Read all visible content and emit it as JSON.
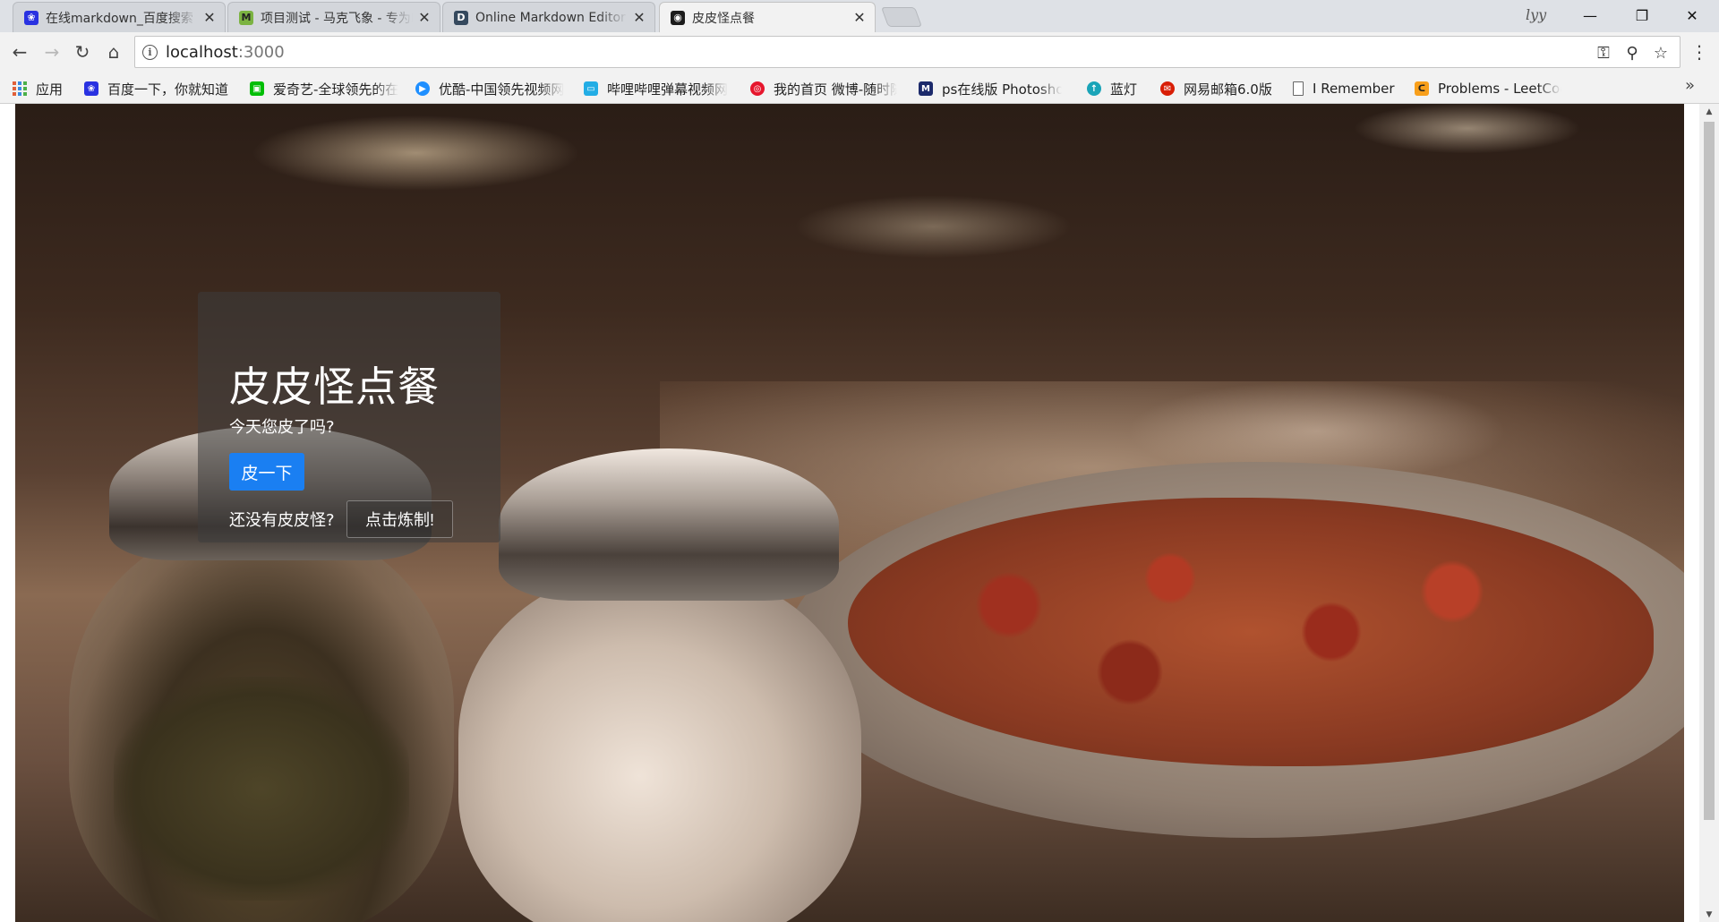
{
  "browser": {
    "tabs": [
      {
        "title": "在线markdown_百度搜索",
        "favicon": "baidu-paw-icon",
        "color": "#2932e1",
        "active": false
      },
      {
        "title": "项目测试 - 马克飞象 - 专为印象笔记打造的Markdown编辑器",
        "favicon": "maxiang-m-icon",
        "color": "#7cb342",
        "active": false
      },
      {
        "title": "Online Markdown Editor - Dillinger",
        "favicon": "dillinger-d-icon",
        "color": "#35495e",
        "active": false
      },
      {
        "title": "皮皮怪点餐",
        "favicon": "page-icon",
        "color": "#1b1b1b",
        "active": true
      }
    ],
    "close_glyph": "✕",
    "profile_name": "lyy",
    "window_controls": {
      "minimize": "—",
      "restore": "❐",
      "close": "✕"
    },
    "nav": {
      "back": "←",
      "forward": "→",
      "reload": "↻",
      "home": "⌂"
    },
    "omnibox": {
      "host": "localhost",
      "port": ":3000",
      "info_glyph": "i"
    },
    "omnibox_icons": {
      "key": "⚿",
      "zoom": "⚲",
      "star": "☆"
    },
    "menu_glyph": "⋮",
    "bookmarks": [
      {
        "label": "应用",
        "icon": "apps-grid-icon",
        "color": ""
      },
      {
        "label": "百度一下，你就知道",
        "icon": "baidu-paw-icon",
        "color": "#2932e1"
      },
      {
        "label": "爱奇艺-全球领先的在线视频网站",
        "icon": "iqiyi-icon",
        "color": "#00be06"
      },
      {
        "label": "优酷-中国领先视频网站",
        "icon": "youku-icon",
        "color": "#1f8fff"
      },
      {
        "label": "哔哩哔哩弹幕视频网",
        "icon": "bilibili-tv-icon",
        "color": "#23ade5"
      },
      {
        "label": "我的首页 微博-随时随地发现新鲜事",
        "icon": "weibo-icon",
        "color": "#e6162d"
      },
      {
        "label": "ps在线版 Photoshop",
        "icon": "ps-icon",
        "color": "#1c2a6b"
      },
      {
        "label": "蓝灯",
        "icon": "lantern-icon",
        "color": "#1aa4b8"
      },
      {
        "label": "网易邮箱6.0版",
        "icon": "netease-mail-icon",
        "color": "#d81e06"
      },
      {
        "label": "I Remember",
        "icon": "document-icon",
        "color": "#ffffff"
      },
      {
        "label": "Problems - LeetCode",
        "icon": "leetcode-icon",
        "color": "#f89f1b"
      }
    ],
    "bookmarks_overflow": "»"
  },
  "page": {
    "heading": "皮皮怪点餐",
    "subtitle": "今天您皮了吗?",
    "primary_button": "皮一下",
    "hint_text": "还没有皮皮怪?",
    "secondary_button": "点击炼制!",
    "accent_color": "#1a7ff2"
  },
  "scrollbar": {
    "up": "▲",
    "down": "▼"
  }
}
